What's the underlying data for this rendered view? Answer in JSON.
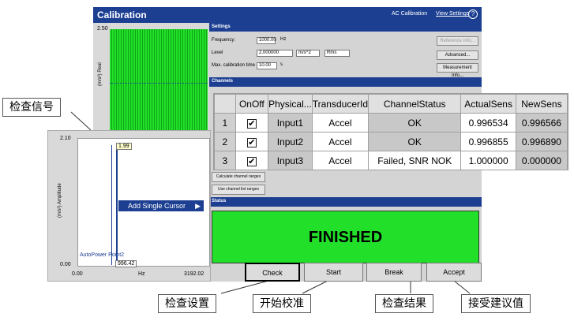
{
  "window": {
    "title": "Calibration",
    "mode": "AC Calibration",
    "view_settings": "View Settings",
    "help": "?"
  },
  "left_plot": {
    "y_top": "2.50",
    "y_label": "(m/s²) Real"
  },
  "settings": {
    "header": "Settings",
    "frequency_label": "Frequency:",
    "frequency_value": "1000.00",
    "frequency_unit": "Hz",
    "level_label": "Level",
    "level_value": "2.000000",
    "level_unit": "m/s^2",
    "level_mode": "Rms",
    "time_label": "Max. calibration time",
    "time_value": "10.00",
    "time_unit": "s",
    "buttons": [
      "Reference Info...",
      "Advanced...",
      "Measurement Info..."
    ]
  },
  "channels": {
    "header": "Channels",
    "columns": [
      "",
      "OnOff",
      "Physical...",
      "TransducerId",
      "ChannelStatus",
      "ActualSens",
      "NewSens"
    ],
    "rows": [
      {
        "num": "1",
        "onoff": "✔",
        "physical": "Input1",
        "transducer": "Accel",
        "status": "OK",
        "actual": "0.996534",
        "new": "0.996566"
      },
      {
        "num": "2",
        "onoff": "✔",
        "physical": "Input2",
        "transducer": "Accel",
        "status": "OK",
        "actual": "0.996855",
        "new": "0.996890"
      },
      {
        "num": "3",
        "onoff": "✔",
        "physical": "Input3",
        "transducer": "Accel",
        "status": "Failed, SNR NOK",
        "actual": "1.000000",
        "new": "0.000000"
      }
    ],
    "calc_button": "Calculate channel ranges",
    "use_button": "Use channel list ranges"
  },
  "status": {
    "header": "Status",
    "text": "FINISHED"
  },
  "buttons": {
    "check": "Check",
    "start": "Start",
    "break": "Break",
    "accept": "Accept"
  },
  "overlay_plot": {
    "y_top": "2.10",
    "y_bottom": "0.00",
    "y_label": "(m/s²) Amplitude",
    "x_left": "0.00",
    "x_unit": "Hz",
    "x_right": "3192.02",
    "cursor_value": "1.99",
    "cursor_freq": "996.42",
    "legend": "AutoPower Point2"
  },
  "context_menu": {
    "item": "Add Single Cursor",
    "arrow": "▶"
  },
  "callouts": {
    "check_signal": "检查信号",
    "check_settings": "检查设置",
    "start_calibration": "开始校准",
    "check_results": "检查结果",
    "accept_suggested": "接受建议值"
  },
  "colors": {
    "title_blue": "#1c3f92",
    "signal_green": "#22e02a",
    "panel_gray": "#d4d4d4"
  }
}
